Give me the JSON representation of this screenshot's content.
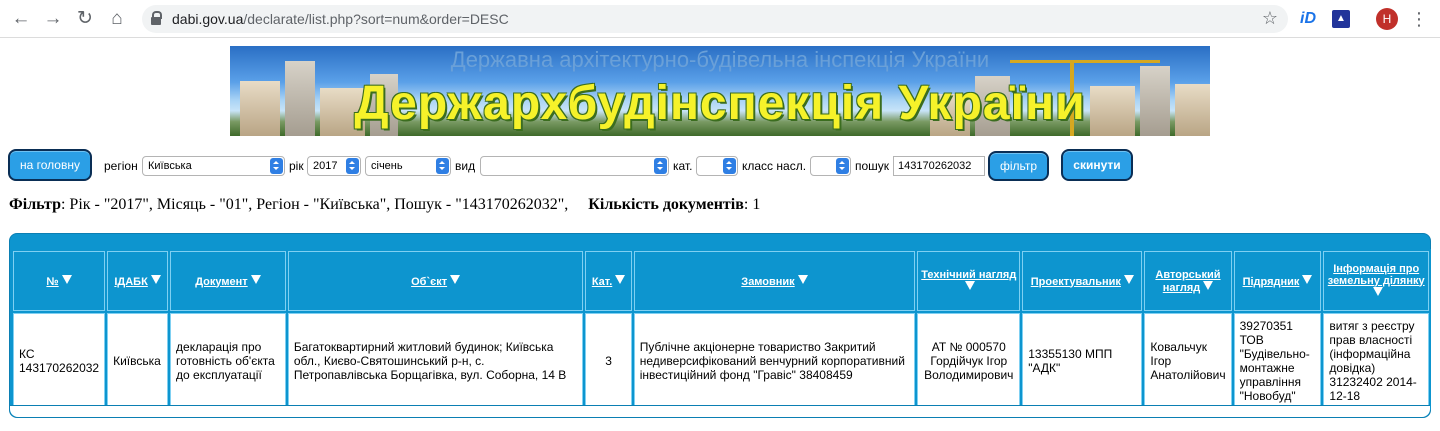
{
  "browser": {
    "url_host": "dabi.gov.ua",
    "url_path": "/declarate/list.php?sort=num&order=DESC",
    "avatar_letter": "H",
    "ext1_label": "iD",
    "back_icon": "back-arrow-icon",
    "forward_icon": "forward-arrow-icon",
    "reload_icon": "reload-icon",
    "home_icon": "home-icon"
  },
  "banner": {
    "subtitle": "Державна архітектурно-будівельна інспекція України",
    "title": "Держархбудінспекція України"
  },
  "filters": {
    "home_button": "на головну",
    "region_label": "регіон",
    "region_value": "Київська",
    "year_label": "рік",
    "year_value": "2017",
    "month_value": "січень",
    "type_label": "вид",
    "type_value": "",
    "category_label": "кат.",
    "category_value": "",
    "class_label": "класс насл.",
    "class_value": "",
    "search_label": "пошук",
    "search_value": "143170262032",
    "filter_button": "фільтр",
    "reset_button": "скинути"
  },
  "summary": {
    "filter_label": "Фільтр",
    "filter_text": ": Рік - \"2017\", Місяць - \"01\", Регіон - \"Київська\", Пошук - \"143170262032\",",
    "count_label": "Кількість документів",
    "count_value": ": 1"
  },
  "table": {
    "headers": [
      "№",
      "ІДАБК",
      "Документ",
      "Об`єкт",
      "Кат.",
      "Замовник",
      "Технічний нагляд",
      "Проектувальник",
      "Авторський нагляд",
      "Підрядник",
      "Інформація про земельну ділянку"
    ],
    "rows": [
      {
        "num": "КС 143170262032",
        "idabk": "Київська",
        "document": "декларація про готовність об'єкта до експлуатації",
        "object": "Багатоквартирний житловий будинок; Київська обл., Києво-Святошинський р-н, с. Петропавлівська Борщагівка, вул. Соборна, 14 В",
        "category": "3",
        "customer": "Публічне акціонерне товариство Закритий недиверсифікований венчурний корпоративний інвестиційний фонд \"Гравіс\" 38408459",
        "tech_supervision": "АТ № 000570 Гордійчук Ігор Володимирович",
        "designer": "13355130 МПП \"АДК\"",
        "author_supervision": "Ковальчук Ігор Анатолійович",
        "contractor": "39270351 ТОВ \"Будівельно-монтажне управління \"Новобуд\"",
        "land_info": "витяг з реєстру прав власності (інформаційна довідка) 31232402 2014-12-18"
      }
    ]
  }
}
